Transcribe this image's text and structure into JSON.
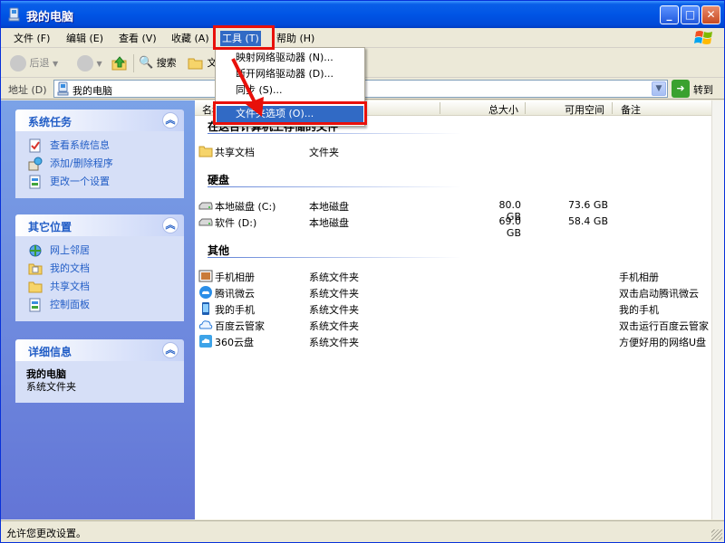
{
  "window": {
    "title": "我的电脑"
  },
  "menubar": {
    "items": [
      "文件 (F)",
      "编辑 (E)",
      "查看 (V)",
      "收藏 (A)",
      "工具 (T)",
      "帮助 (H)"
    ]
  },
  "toolbar": {
    "back": "后退",
    "search": "搜索",
    "folders": "文"
  },
  "address": {
    "label": "地址 (D)",
    "value": "我的电脑",
    "go": "转到"
  },
  "dropdown": {
    "items": [
      "映射网络驱动器 (N)...",
      "断开网络驱动器 (D)...",
      "同步 (S)...",
      "文件夹选项 (O)..."
    ],
    "selected_index": 3
  },
  "sidebar": {
    "tasks": {
      "title": "系统任务",
      "items": [
        "查看系统信息",
        "添加/删除程序",
        "更改一个设置"
      ]
    },
    "places": {
      "title": "其它位置",
      "items": [
        "网上邻居",
        "我的文档",
        "共享文档",
        "控制面板"
      ]
    },
    "details": {
      "title": "详细信息",
      "name": "我的电脑",
      "type": "系统文件夹"
    }
  },
  "columns": {
    "name": "名称",
    "total": "总大小",
    "free": "可用空间",
    "notes": "备注"
  },
  "groups": {
    "stored": {
      "title": "在这台计算机上存储的文件",
      "rows": [
        {
          "name": "共享文档",
          "type": "文件夹"
        }
      ]
    },
    "drives": {
      "title": "硬盘",
      "rows": [
        {
          "name": "本地磁盘 (C:)",
          "type": "本地磁盘",
          "total": "80.0 GB",
          "free": "73.6 GB"
        },
        {
          "name": "软件 (D:)",
          "type": "本地磁盘",
          "total": "69.0 GB",
          "free": "58.4 GB"
        }
      ]
    },
    "other": {
      "title": "其他",
      "rows": [
        {
          "name": "手机相册",
          "type": "系统文件夹",
          "note": "手机相册"
        },
        {
          "name": "腾讯微云",
          "type": "系统文件夹",
          "note": "双击启动腾讯微云"
        },
        {
          "name": "我的手机",
          "type": "系统文件夹",
          "note": "我的手机"
        },
        {
          "name": "百度云管家",
          "type": "系统文件夹",
          "note": "双击运行百度云管家"
        },
        {
          "name": "360云盘",
          "type": "系统文件夹",
          "note": "方便好用的网络U盘"
        }
      ]
    }
  },
  "status": {
    "text": "允许您更改设置。"
  },
  "colors": {
    "highlight": "#e8100a",
    "selection": "#316ac5",
    "taskpane": "#6f8fe0"
  }
}
